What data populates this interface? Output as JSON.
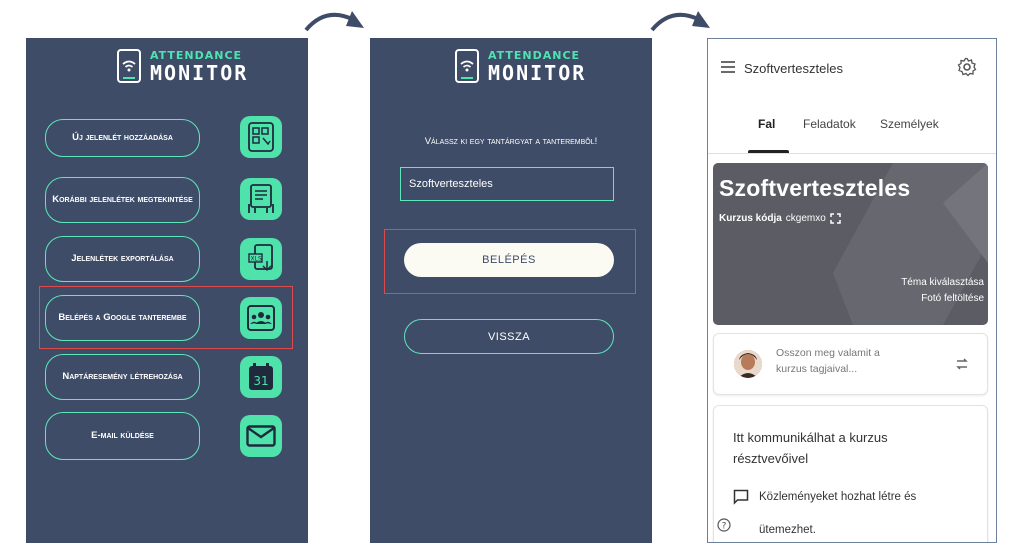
{
  "colors": {
    "panel_bg": "#3e4c67",
    "accent": "#4fe3ab",
    "highlight": "#de4a4a",
    "banner": "#5b5c64"
  },
  "app": {
    "logo_top": "ATTENDANCE",
    "logo_bottom": "MONITOR"
  },
  "screen1": {
    "menu": [
      {
        "label": "Új jelenlét hozzáadása",
        "icon": "qr-scan-icon"
      },
      {
        "label": "Korábbi jelenlétek megtekintése",
        "icon": "clipboard-list-icon"
      },
      {
        "label": "Jelenlétek exportálása",
        "icon": "xls-export-icon"
      },
      {
        "label": "Belépés a Google tanterembe",
        "icon": "google-classroom-icon"
      },
      {
        "label": "Naptáresemény létrehozása",
        "icon": "calendar-icon"
      },
      {
        "label": "E-mail küldése",
        "icon": "mail-icon"
      }
    ],
    "calendar_day": "31"
  },
  "screen2": {
    "prompt": "Válassz ki egy tantárgyat a tanterembõl!",
    "course_value": "Szoftverteszteles",
    "login_button": "BELÉPÉS",
    "back_button": "VISSZA"
  },
  "screen3": {
    "title": "Szoftverteszteles",
    "tabs": [
      "Fal",
      "Feladatok",
      "Személyek"
    ],
    "active_tab": "Fal",
    "banner_title": "Szoftverteszteles",
    "course_code_label": "Kurzus kódja",
    "course_code": "ckgemxo",
    "select_theme": "Téma kiválasztása",
    "upload_photo": "Fotó feltöltése",
    "share_line1": "Osszon meg valamit a",
    "share_line2": "kurzus tagjaival...",
    "info_line1": "Itt kommunikálhat a kurzus",
    "info_line2": "résztvevőivel",
    "announce_line1": "Közleményeket hozhat létre és",
    "announce_line2": "ütemezhet."
  }
}
